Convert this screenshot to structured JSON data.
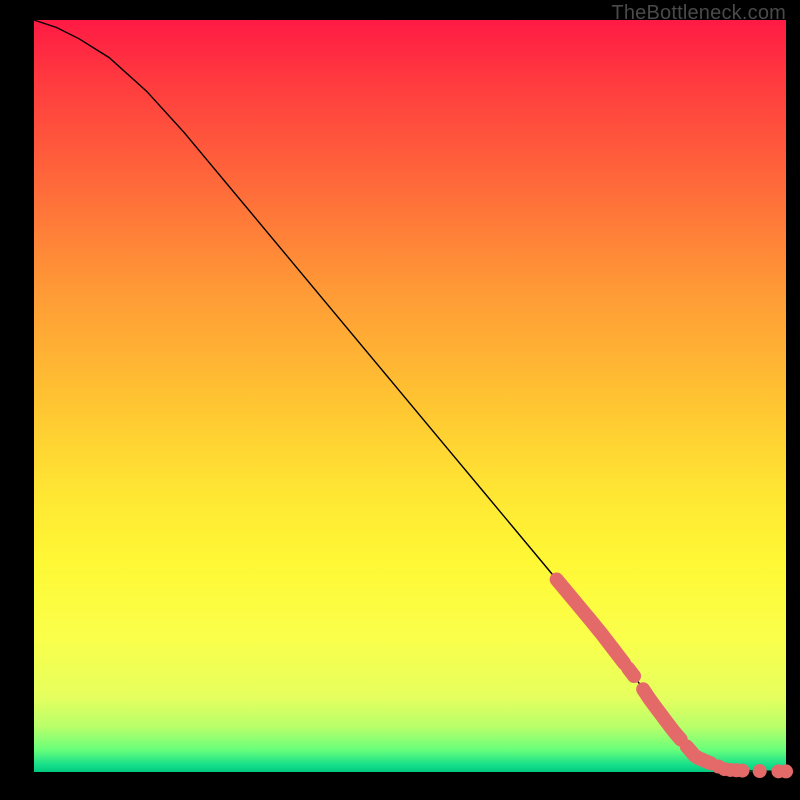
{
  "watermark": "TheBottleneck.com",
  "chart_data": {
    "type": "line",
    "title": "",
    "xlabel": "",
    "ylabel": "",
    "xlim": [
      0,
      100
    ],
    "ylim": [
      0,
      100
    ],
    "grid": false,
    "legend": false,
    "curve": {
      "x": [
        0,
        3,
        6,
        10,
        15,
        20,
        25,
        30,
        35,
        40,
        45,
        50,
        55,
        60,
        65,
        70,
        75,
        80,
        82,
        85,
        88,
        92,
        95,
        98,
        100
      ],
      "y": [
        100,
        99,
        97.5,
        95,
        90.5,
        85,
        79,
        73,
        67,
        61,
        55,
        49,
        43,
        37,
        31,
        25,
        19,
        12.5,
        9.5,
        5.5,
        2,
        0.3,
        0.15,
        0.1,
        0.08
      ]
    },
    "highlight_segments_on_curve_x": [
      [
        69.5,
        78.5
      ],
      [
        79.0,
        79.8
      ],
      [
        81.0,
        86.0
      ],
      [
        86.8,
        90.0
      ]
    ],
    "bottom_dots_x": [
      91.0,
      91.8,
      92.6,
      93.4,
      94.2,
      96.5,
      99.0,
      100.0
    ],
    "colors": {
      "curve": "#000000",
      "marker": "#e46a6a",
      "gradient_top": "#ff1a44",
      "gradient_bottom": "#00c97f"
    }
  }
}
